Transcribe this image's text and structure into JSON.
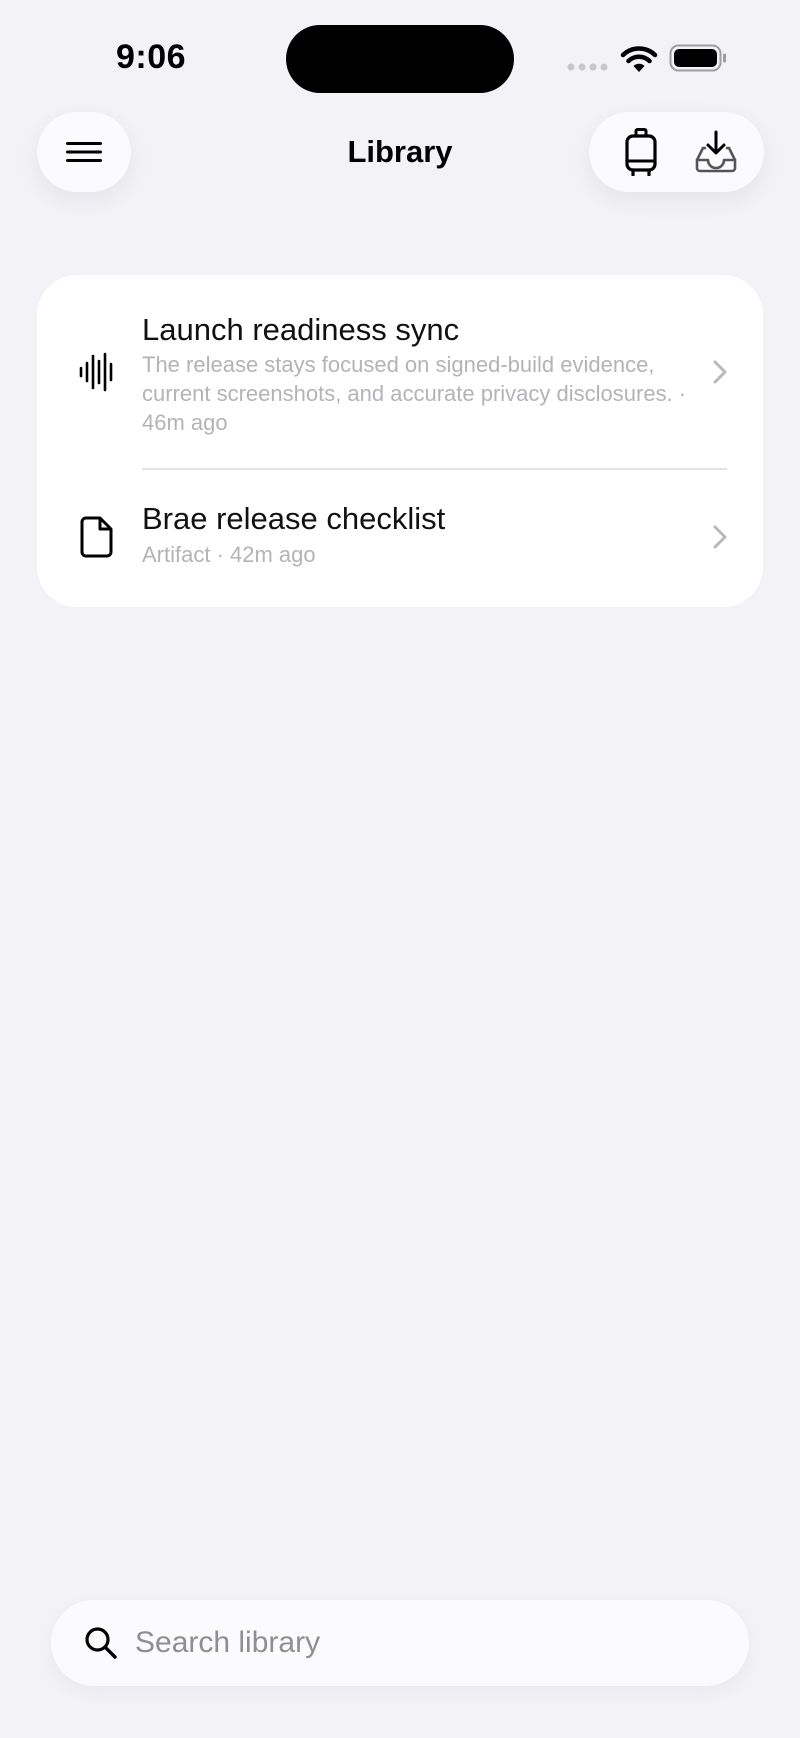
{
  "status_bar": {
    "time": "9:06"
  },
  "header": {
    "title": "Library",
    "icons": {
      "menu": "menu-icon",
      "luggage": "luggage-icon",
      "inbox": "inbox-download-icon"
    }
  },
  "library": {
    "items": [
      {
        "icon": "waveform-icon",
        "title": "Launch readiness sync",
        "subtitle": "The release stays focused on signed-build evidence, current screenshots, and accurate privacy disclosures. · 46m ago"
      },
      {
        "icon": "document-icon",
        "title": "Brae release checklist",
        "subtitle": "Artifact · 42m ago"
      }
    ]
  },
  "search": {
    "placeholder": "Search library",
    "value": ""
  },
  "colors": {
    "background": "#f2f2f7",
    "card": "#ffffff",
    "secondary_text": "#b3b3b8",
    "placeholder": "#8e8e93"
  }
}
